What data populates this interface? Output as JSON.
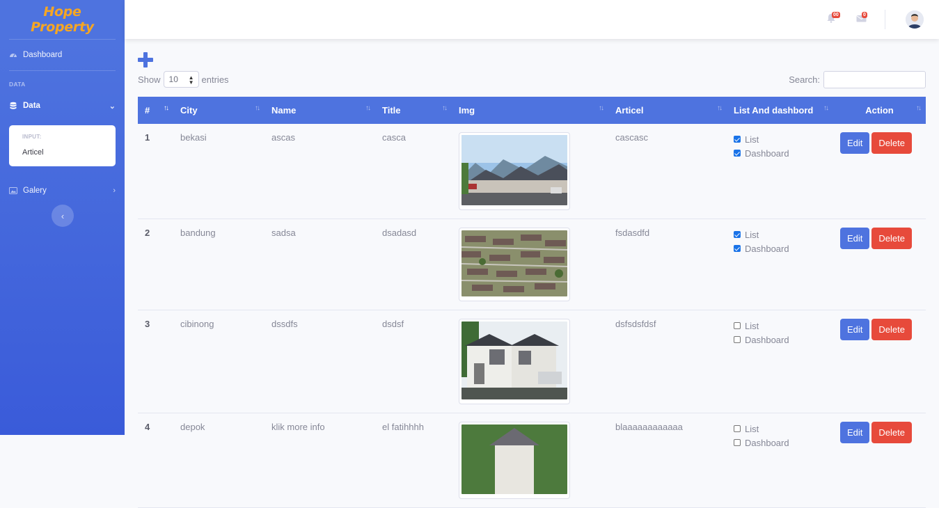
{
  "brand": {
    "line1": "Hope",
    "line2": "Property"
  },
  "sidebar": {
    "dashboard": "Dashboard",
    "heading": "DATA",
    "data": "Data",
    "collapse_heading": "INPUT:",
    "collapse_item": "Articel",
    "galery": "Galery"
  },
  "topbar": {
    "alerts_count": "00",
    "messages_count": "0"
  },
  "controls": {
    "show": "Show",
    "entries_value": "10",
    "entries": "entries",
    "search": "Search:"
  },
  "table": {
    "headers": [
      "#",
      "City",
      "Name",
      "Title",
      "Img",
      "Articel",
      "List And dashbord",
      "Action"
    ],
    "check_labels": {
      "list": "List",
      "dashboard": "Dashboard"
    },
    "edit": "Edit",
    "delete": "Delete",
    "rows": [
      {
        "num": "1",
        "city": "bekasi",
        "name": "ascas",
        "title": "casca",
        "articel": "cascasc",
        "list": true,
        "dashboard": true
      },
      {
        "num": "2",
        "city": "bandung",
        "name": "sadsa",
        "title": "dsadasd",
        "articel": "fsdasdfd",
        "list": true,
        "dashboard": true
      },
      {
        "num": "3",
        "city": "cibinong",
        "name": "dssdfs",
        "title": "dsdsf",
        "articel": "dsfsdsfdsf",
        "list": false,
        "dashboard": false
      },
      {
        "num": "4",
        "city": "depok",
        "name": "klik more info",
        "title": "el fatihhhh",
        "articel": "blaaaaaaaaaaaa",
        "list": false,
        "dashboard": false
      }
    ]
  },
  "colors": {
    "primary": "#4e73df",
    "danger": "#e74a3b",
    "brand": "#f6a623"
  }
}
